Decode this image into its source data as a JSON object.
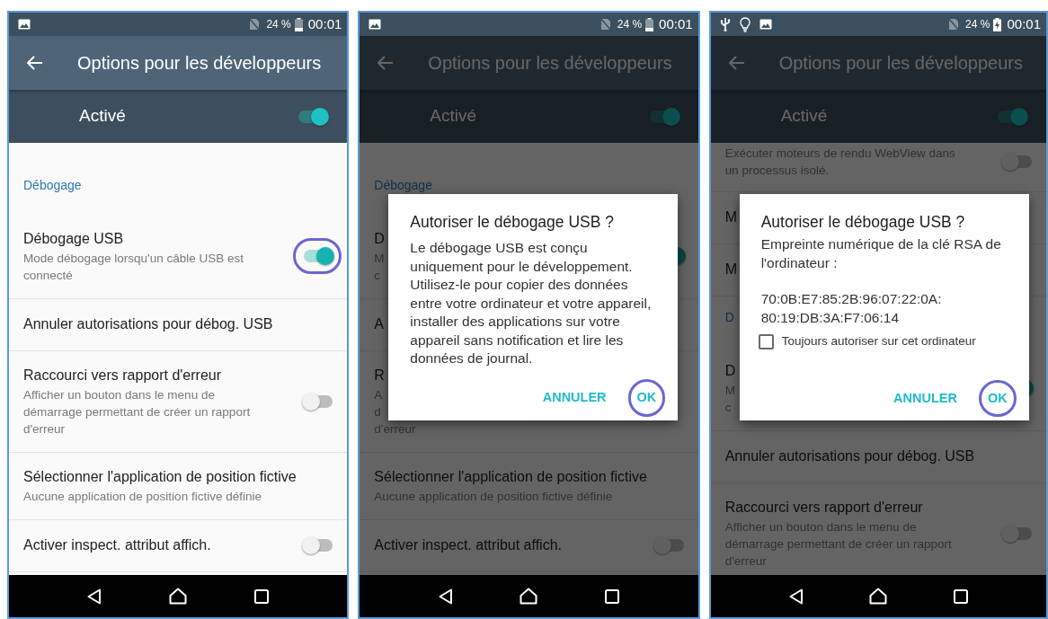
{
  "phones": [
    {
      "status_bar": {
        "left_icons": [
          {
            "kind": "image"
          }
        ],
        "battery_text": "24 %",
        "battery_charging": false,
        "time": "00:01"
      },
      "title": "Options pour les développeurs",
      "master": {
        "label": "Activé",
        "on": true
      },
      "dimmed": false,
      "rows": [
        {
          "kind": "section",
          "title": "Débogage"
        },
        {
          "kind": "setting",
          "title": "Débogage USB",
          "subtitle": "Mode débogage lorsqu'un câble USB est connecté",
          "toggle": {
            "on": true,
            "highlighted": true
          }
        },
        {
          "kind": "setting",
          "title": "Annuler autorisations pour débog. USB"
        },
        {
          "kind": "setting",
          "title": "Raccourci vers rapport d'erreur",
          "subtitle": "Afficher un bouton dans le menu de démarrage permettant de créer un rapport d'erreur",
          "toggle": {
            "on": false,
            "highlighted": false
          }
        },
        {
          "kind": "setting",
          "title": "Sélectionner l'application de position fictive",
          "subtitle": "Aucune application de position fictive définie"
        },
        {
          "kind": "setting",
          "title": "Activer inspect. attribut affich.",
          "toggle": {
            "on": false,
            "highlighted": false
          }
        }
      ]
    },
    {
      "status_bar": {
        "left_icons": [
          {
            "kind": "image"
          }
        ],
        "battery_text": "24 %",
        "battery_charging": false,
        "time": "00:01"
      },
      "title": "Options pour les développeurs",
      "master": {
        "label": "Activé",
        "on": true
      },
      "dimmed": true,
      "rows": [
        {
          "kind": "section",
          "title": "Débogage"
        },
        {
          "kind": "setting",
          "title": "D",
          "subtitle_lines": [
            "M",
            "c"
          ],
          "toggle": {
            "on": true,
            "highlighted": false
          }
        },
        {
          "kind": "setting",
          "title": "A"
        },
        {
          "kind": "setting",
          "title": "R",
          "subtitle_lines": [
            "A",
            "d",
            "d'erreur"
          ]
        },
        {
          "kind": "setting",
          "title": "Sélectionner l'application de position fictive",
          "subtitle": "Aucune application de position fictive définie"
        },
        {
          "kind": "setting",
          "title": "Activer inspect. attribut affich.",
          "toggle": {
            "on": false,
            "highlighted": false
          }
        }
      ],
      "dialog": {
        "title": "Autoriser le débogage USB ?",
        "body": "Le débogage USB est conçu uniquement pour le développement. Utilisez-le pour copier des données entre votre ordinateur et votre appareil, installer des applications sur votre appareil sans notification et lire les données de journal.",
        "buttons": [
          {
            "label": "ANNULER",
            "highlighted": false
          },
          {
            "label": "OK",
            "highlighted": true
          }
        ]
      }
    },
    {
      "status_bar": {
        "left_icons": [
          {
            "kind": "usb"
          },
          {
            "kind": "bulb"
          },
          {
            "kind": "image"
          }
        ],
        "battery_text": "24 %",
        "battery_charging": true,
        "time": "00:01"
      },
      "title": "Options pour les développeurs",
      "master": {
        "label": "Activé",
        "on": true
      },
      "dimmed": true,
      "rows": [
        {
          "kind": "setting",
          "subtitle": "Exécuter moteurs de rendu WebView dans un processus isolé.",
          "toggle": {
            "on": false,
            "highlighted": false
          }
        },
        {
          "kind": "setting",
          "title": "M"
        },
        {
          "kind": "setting",
          "title": "M"
        },
        {
          "kind": "section",
          "title": "D"
        },
        {
          "kind": "setting",
          "title": "D",
          "subtitle_lines": [
            "M",
            "c"
          ],
          "toggle": {
            "on": true,
            "highlighted": false
          }
        },
        {
          "kind": "setting",
          "title": "Annuler autorisations pour débog. USB"
        },
        {
          "kind": "setting",
          "title": "Raccourci vers rapport d'erreur",
          "subtitle": "Afficher un bouton dans le menu de démarrage permettant de créer un rapport d'erreur",
          "toggle": {
            "on": false,
            "highlighted": false
          }
        }
      ],
      "dialog": {
        "title": "Autoriser le débogage USB ?",
        "body": "Empreinte numérique de la clé RSA de l'ordinateur :",
        "fingerprint_lines": [
          "70:0B:E7:85:2B:96:07:22:0A:",
          "80:19:DB:3A:F7:06:14"
        ],
        "checkbox": {
          "label": "Toujours autoriser sur cet ordinateur",
          "checked": false
        },
        "buttons": [
          {
            "label": "ANNULER",
            "highlighted": false
          },
          {
            "label": "OK",
            "highlighted": true
          }
        ]
      }
    }
  ]
}
